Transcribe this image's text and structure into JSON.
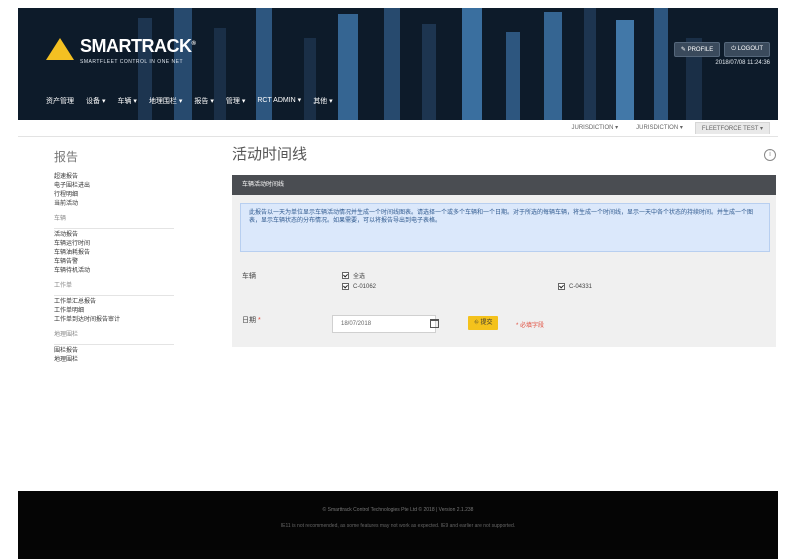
{
  "brand": {
    "logo_text": "SMARTRACK",
    "logo_mark": "®",
    "tagline": "SMARTFLEET CONTROL IN ONE NET"
  },
  "header": {
    "profile_button": "✎ PROFILE",
    "logout_button": "⏻ LOGOUT",
    "datetime": "2018/07/08 11:24:36"
  },
  "nav": {
    "items": [
      {
        "label": "资产管理"
      },
      {
        "label": "设备 ▾"
      },
      {
        "label": "车辆 ▾"
      },
      {
        "label": "地理围栏 ▾"
      },
      {
        "label": "报告 ▾"
      },
      {
        "label": "管理 ▾"
      },
      {
        "label": "RCT ADMIN ▾"
      },
      {
        "label": "其他 ▾"
      }
    ]
  },
  "subnav": {
    "items": [
      {
        "label": "JURISDICTION ▾",
        "active": false
      },
      {
        "label": "JURISDICTION ▾",
        "active": false
      },
      {
        "label": "FLEETFORCE TEST ▾",
        "active": true
      }
    ]
  },
  "sidebar": {
    "title": "报告",
    "sections": [
      {
        "items": [
          "超速报告",
          "电子围栏进出",
          "行程明细",
          "当前活动"
        ]
      },
      {
        "heading": "车辆",
        "items": [
          "活动报告",
          "车辆运行时间",
          "车辆油耗报告",
          "车辆告警",
          "车辆待机活动"
        ]
      },
      {
        "heading": "工作单",
        "items": [
          "工作单汇总报告",
          "工作单明细",
          "工作单到达时间报告审计"
        ]
      },
      {
        "heading": "地理围栏",
        "items": [
          "围栏报告",
          "地理围栏"
        ]
      }
    ]
  },
  "main": {
    "page_title": "活动时间线",
    "panel_title": "车辆活动时间线",
    "help_text": "此报告以一天为单位显示车辆活动情况并生成一个时间线图表。请选择一个或多个车辆和一个日期。对于所选的每辆车辆，将生成一个时间线，显示一天中各个状态的持续时间。并生成一个图表，显示车辆状态的分布情况。如果需要，可以将报告导出到电子表格。",
    "vehicle_label": "车辆",
    "select_all_label": "全选",
    "vehicle_1": "C-01062",
    "vehicle_2": "C-04331",
    "date_label": "日期",
    "required_star": "*",
    "date_value": "18/07/2018",
    "submit_label": "⛗ 提交",
    "required_note": "* 必填字段"
  },
  "footer": {
    "line1": "© Smarttrack Control Technologies Pte Ltd © 2018 | Version 2.1.238",
    "line2": "IE11 is not recommended, as some features may not work as expected. IE9 and earlier are not supported."
  },
  "colors": {
    "header_bg": "#0d1b2a",
    "accent": "#f4c21c",
    "panel_head": "#4a4d52",
    "help_bg": "#dbe8fb",
    "required": "#e04a3a"
  }
}
